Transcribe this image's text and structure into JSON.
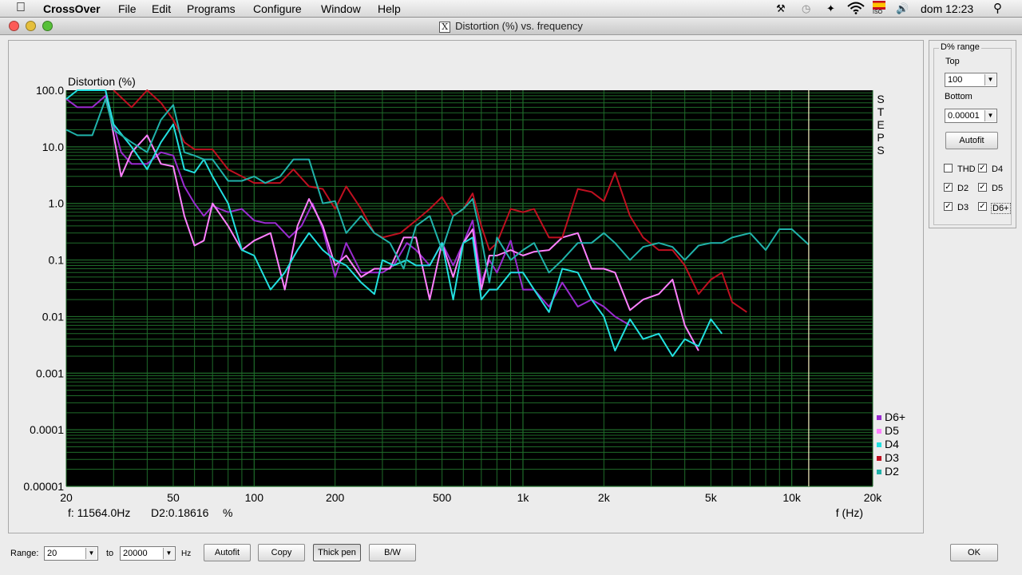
{
  "menubar": {
    "app": "CrossOver",
    "items": [
      "File",
      "Edit",
      "Programs",
      "Configure",
      "Window",
      "Help"
    ],
    "clock": "dom 12:23",
    "flag_badge": "ISO"
  },
  "window": {
    "title": "Distortion (%) vs. frequency",
    "title_icon": "X"
  },
  "readout": {
    "freq": "f:  11564.0Hz",
    "value": "D2:0.18616",
    "unit": "%"
  },
  "sidepanel": {
    "group_label": "D% range",
    "top_label": "Top",
    "top_value": "100",
    "bottom_label": "Bottom",
    "bottom_value": "0.00001",
    "autofit": "Autofit",
    "checks": [
      {
        "label": "THD",
        "checked": false
      },
      {
        "label": "D4",
        "checked": true
      },
      {
        "label": "D2",
        "checked": true
      },
      {
        "label": "D5",
        "checked": true
      },
      {
        "label": "D3",
        "checked": true
      },
      {
        "label": "D6+",
        "checked": true
      }
    ]
  },
  "bottombar": {
    "range_label": "Range:",
    "from_value": "20",
    "to_label": "to",
    "to_value": "20000",
    "hz_label": "Hz",
    "autofit": "Autofit",
    "copy": "Copy",
    "thick_pen": "Thick pen",
    "bw": "B/W",
    "ok": "OK"
  },
  "chart_data": {
    "type": "line",
    "ylabel": "Distortion (%)",
    "xlabel": "f (Hz)",
    "side_label": "STEPS",
    "xscale": "log",
    "yscale": "log",
    "xlim": [
      20,
      20000
    ],
    "ylim": [
      1e-05,
      100
    ],
    "xticks": [
      20,
      50,
      100,
      200,
      500,
      1000,
      2000,
      5000,
      10000,
      20000
    ],
    "xtick_labels": [
      "20",
      "50",
      "100",
      "200",
      "500",
      "1k",
      "2k",
      "5k",
      "10k",
      "20k"
    ],
    "yticks": [
      100,
      10,
      1,
      0.1,
      0.01,
      0.001,
      0.0001,
      1e-05
    ],
    "ytick_labels": [
      "100.0",
      "10.0",
      "1.0",
      "0.1",
      "0.01",
      "0.001",
      "0.0001",
      "0.00001"
    ],
    "cursor_x": 11564,
    "background": "#000000",
    "grid_color": "#1f6b2a",
    "legend_position": "bottom-right",
    "series": [
      {
        "name": "D6+",
        "color": "#9a2bd0",
        "points": [
          [
            20,
            70
          ],
          [
            22,
            50
          ],
          [
            25,
            50
          ],
          [
            28,
            80
          ],
          [
            32,
            8
          ],
          [
            35,
            5
          ],
          [
            40,
            5
          ],
          [
            45,
            8
          ],
          [
            50,
            7
          ],
          [
            55,
            2
          ],
          [
            60,
            1
          ],
          [
            65,
            0.6
          ],
          [
            70,
            0.9
          ],
          [
            80,
            0.7
          ],
          [
            90,
            0.8
          ],
          [
            100,
            0.5
          ],
          [
            110,
            0.45
          ],
          [
            120,
            0.45
          ],
          [
            135,
            0.25
          ],
          [
            150,
            0.4
          ],
          [
            165,
            1.0
          ],
          [
            180,
            0.35
          ],
          [
            200,
            0.05
          ],
          [
            220,
            0.2
          ],
          [
            250,
            0.06
          ],
          [
            280,
            0.06
          ],
          [
            300,
            0.06
          ],
          [
            330,
            0.08
          ],
          [
            370,
            0.2
          ],
          [
            400,
            0.15
          ],
          [
            450,
            0.08
          ],
          [
            500,
            0.2
          ],
          [
            550,
            0.08
          ],
          [
            600,
            0.2
          ],
          [
            650,
            0.5
          ],
          [
            700,
            0.04
          ],
          [
            750,
            0.1
          ],
          [
            800,
            0.06
          ],
          [
            900,
            0.22
          ],
          [
            1000,
            0.03
          ],
          [
            1100,
            0.03
          ],
          [
            1250,
            0.015
          ],
          [
            1400,
            0.04
          ],
          [
            1600,
            0.015
          ],
          [
            1800,
            0.02
          ],
          [
            2000,
            0.015
          ],
          [
            2200,
            0.01
          ],
          [
            2500,
            0.007
          ]
        ]
      },
      {
        "name": "D5",
        "color": "#ff80ff",
        "points": [
          [
            28,
            100
          ],
          [
            32,
            3
          ],
          [
            35,
            8
          ],
          [
            40,
            16
          ],
          [
            45,
            5
          ],
          [
            50,
            4.5
          ],
          [
            55,
            0.6
          ],
          [
            60,
            0.18
          ],
          [
            65,
            0.22
          ],
          [
            70,
            1.0
          ],
          [
            80,
            0.4
          ],
          [
            90,
            0.15
          ],
          [
            100,
            0.22
          ],
          [
            115,
            0.3
          ],
          [
            130,
            0.03
          ],
          [
            145,
            0.4
          ],
          [
            160,
            1.2
          ],
          [
            180,
            0.4
          ],
          [
            200,
            0.08
          ],
          [
            220,
            0.12
          ],
          [
            250,
            0.05
          ],
          [
            280,
            0.07
          ],
          [
            320,
            0.07
          ],
          [
            360,
            0.25
          ],
          [
            400,
            0.25
          ],
          [
            450,
            0.02
          ],
          [
            500,
            0.2
          ],
          [
            550,
            0.05
          ],
          [
            600,
            0.2
          ],
          [
            650,
            0.35
          ],
          [
            700,
            0.03
          ],
          [
            750,
            0.12
          ],
          [
            800,
            0.12
          ],
          [
            900,
            0.15
          ],
          [
            1000,
            0.12
          ],
          [
            1100,
            0.14
          ],
          [
            1250,
            0.15
          ],
          [
            1400,
            0.25
          ],
          [
            1600,
            0.3
          ],
          [
            1800,
            0.07
          ],
          [
            2000,
            0.07
          ],
          [
            2200,
            0.06
          ],
          [
            2500,
            0.013
          ],
          [
            2800,
            0.02
          ],
          [
            3200,
            0.025
          ],
          [
            3600,
            0.045
          ],
          [
            4000,
            0.007
          ],
          [
            4500,
            0.0025
          ]
        ]
      },
      {
        "name": "D4",
        "color": "#22e0e0",
        "points": [
          [
            20,
            70
          ],
          [
            22,
            100
          ],
          [
            25,
            100
          ],
          [
            28,
            100
          ],
          [
            30,
            25
          ],
          [
            35,
            10
          ],
          [
            40,
            4
          ],
          [
            45,
            12
          ],
          [
            50,
            25
          ],
          [
            55,
            4
          ],
          [
            60,
            3.5
          ],
          [
            65,
            6
          ],
          [
            70,
            3
          ],
          [
            80,
            1
          ],
          [
            90,
            0.15
          ],
          [
            100,
            0.12
          ],
          [
            115,
            0.03
          ],
          [
            130,
            0.06
          ],
          [
            145,
            0.15
          ],
          [
            160,
            0.3
          ],
          [
            180,
            0.15
          ],
          [
            200,
            0.1
          ],
          [
            220,
            0.08
          ],
          [
            250,
            0.04
          ],
          [
            280,
            0.025
          ],
          [
            300,
            0.1
          ],
          [
            330,
            0.08
          ],
          [
            370,
            0.1
          ],
          [
            400,
            0.08
          ],
          [
            450,
            0.08
          ],
          [
            500,
            0.2
          ],
          [
            550,
            0.02
          ],
          [
            600,
            0.2
          ],
          [
            650,
            0.25
          ],
          [
            700,
            0.02
          ],
          [
            750,
            0.03
          ],
          [
            800,
            0.03
          ],
          [
            900,
            0.06
          ],
          [
            1000,
            0.06
          ],
          [
            1100,
            0.03
          ],
          [
            1250,
            0.012
          ],
          [
            1400,
            0.07
          ],
          [
            1600,
            0.06
          ],
          [
            1800,
            0.02
          ],
          [
            2000,
            0.01
          ],
          [
            2200,
            0.0025
          ],
          [
            2500,
            0.009
          ],
          [
            2800,
            0.004
          ],
          [
            3200,
            0.005
          ],
          [
            3600,
            0.002
          ],
          [
            4000,
            0.004
          ],
          [
            4500,
            0.003
          ],
          [
            5000,
            0.009
          ],
          [
            5500,
            0.005
          ]
        ]
      },
      {
        "name": "D3",
        "color": "#c01020",
        "points": [
          [
            30,
            100
          ],
          [
            35,
            50
          ],
          [
            40,
            100
          ],
          [
            45,
            60
          ],
          [
            50,
            30
          ],
          [
            55,
            12
          ],
          [
            60,
            9
          ],
          [
            70,
            9
          ],
          [
            80,
            4
          ],
          [
            90,
            3
          ],
          [
            100,
            2.3
          ],
          [
            110,
            2.3
          ],
          [
            125,
            2.3
          ],
          [
            140,
            4
          ],
          [
            160,
            2
          ],
          [
            180,
            1.8
          ],
          [
            200,
            0.8
          ],
          [
            220,
            2
          ],
          [
            250,
            0.8
          ],
          [
            280,
            0.3
          ],
          [
            300,
            0.25
          ],
          [
            350,
            0.3
          ],
          [
            400,
            0.5
          ],
          [
            450,
            0.8
          ],
          [
            500,
            1.3
          ],
          [
            550,
            0.6
          ],
          [
            600,
            0.8
          ],
          [
            650,
            1.5
          ],
          [
            700,
            0.4
          ],
          [
            750,
            0.15
          ],
          [
            800,
            0.2
          ],
          [
            900,
            0.8
          ],
          [
            1000,
            0.7
          ],
          [
            1100,
            0.8
          ],
          [
            1250,
            0.25
          ],
          [
            1400,
            0.25
          ],
          [
            1600,
            1.8
          ],
          [
            1800,
            1.6
          ],
          [
            2000,
            1.1
          ],
          [
            2200,
            3.5
          ],
          [
            2500,
            0.6
          ],
          [
            2800,
            0.25
          ],
          [
            3200,
            0.15
          ],
          [
            3600,
            0.15
          ],
          [
            4000,
            0.08
          ],
          [
            4500,
            0.025
          ],
          [
            5000,
            0.045
          ],
          [
            5500,
            0.06
          ],
          [
            6000,
            0.018
          ],
          [
            6800,
            0.012
          ]
        ]
      },
      {
        "name": "D2",
        "color": "#20b2aa",
        "points": [
          [
            20,
            20
          ],
          [
            22,
            16
          ],
          [
            25,
            16
          ],
          [
            28,
            70
          ],
          [
            30,
            20
          ],
          [
            35,
            12
          ],
          [
            40,
            8
          ],
          [
            45,
            30
          ],
          [
            50,
            55
          ],
          [
            55,
            8
          ],
          [
            60,
            7
          ],
          [
            65,
            6
          ],
          [
            70,
            6
          ],
          [
            80,
            2.5
          ],
          [
            90,
            2.5
          ],
          [
            100,
            3
          ],
          [
            110,
            2.3
          ],
          [
            125,
            3
          ],
          [
            140,
            6
          ],
          [
            160,
            6
          ],
          [
            180,
            1
          ],
          [
            200,
            1.1
          ],
          [
            220,
            0.3
          ],
          [
            250,
            0.6
          ],
          [
            280,
            0.3
          ],
          [
            320,
            0.2
          ],
          [
            360,
            0.07
          ],
          [
            400,
            0.4
          ],
          [
            450,
            0.6
          ],
          [
            500,
            0.15
          ],
          [
            550,
            0.6
          ],
          [
            600,
            0.8
          ],
          [
            650,
            1.2
          ],
          [
            700,
            0.25
          ],
          [
            750,
            0.04
          ],
          [
            800,
            0.25
          ],
          [
            900,
            0.1
          ],
          [
            1000,
            0.15
          ],
          [
            1100,
            0.2
          ],
          [
            1250,
            0.06
          ],
          [
            1400,
            0.1
          ],
          [
            1600,
            0.2
          ],
          [
            1800,
            0.2
          ],
          [
            2000,
            0.3
          ],
          [
            2200,
            0.2
          ],
          [
            2500,
            0.1
          ],
          [
            2800,
            0.17
          ],
          [
            3200,
            0.2
          ],
          [
            3600,
            0.17
          ],
          [
            4000,
            0.1
          ],
          [
            4500,
            0.18
          ],
          [
            5000,
            0.2
          ],
          [
            5500,
            0.2
          ],
          [
            6000,
            0.25
          ],
          [
            7000,
            0.3
          ],
          [
            8000,
            0.15
          ],
          [
            9000,
            0.35
          ],
          [
            10000,
            0.35
          ],
          [
            11564,
            0.18616
          ]
        ]
      }
    ]
  }
}
